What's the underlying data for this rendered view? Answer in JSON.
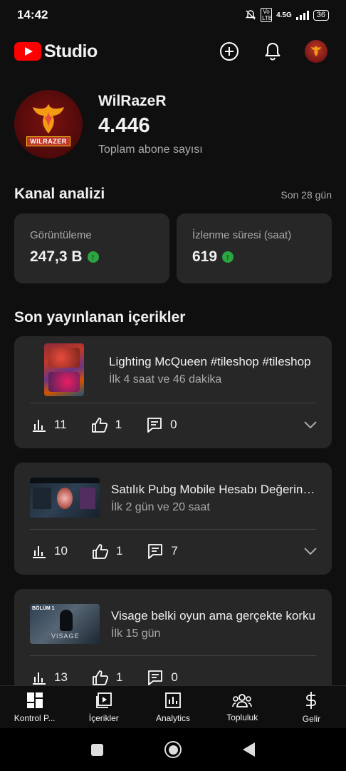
{
  "status": {
    "time": "14:42",
    "network": "4.5G",
    "volte": "Vo LTE",
    "battery": "36"
  },
  "header": {
    "logo_text": "Studio",
    "add_icon": "add-circle-icon",
    "bell_icon": "bell-icon"
  },
  "channel": {
    "name": "WilRazeR",
    "subscribers": "4.446",
    "subscribers_label": "Toplam abone sayısı",
    "avatar_brand": "WILRAZER"
  },
  "analytics": {
    "title": "Kanal analizi",
    "period": "Son 28 gün",
    "cards": [
      {
        "label": "Görüntüleme",
        "value": "247,3 B",
        "trend": "up"
      },
      {
        "label": "İzlenme süresi (saat)",
        "value": "619",
        "trend": "up"
      }
    ]
  },
  "recent": {
    "title": "Son yayınlanan içerikler",
    "videos": [
      {
        "title": "Lighting McQueen #tileshop #tileshop",
        "time": "İlk 4 saat ve 46 dakika",
        "views": "11",
        "likes": "1",
        "comments": "0",
        "thumb_style": "vertical"
      },
      {
        "title": "Satılık Pubg Mobile Hesabı Değerini Öğren",
        "time": "İlk 2 gün ve 20 saat",
        "views": "10",
        "likes": "1",
        "comments": "7",
        "thumb_style": "pubg"
      },
      {
        "title": "Visage belki oyun ama gerçekte korku",
        "time": "İlk 15 gün",
        "views": "13",
        "likes": "1",
        "comments": "0",
        "thumb_style": "visage",
        "thumb_text": "VISAGE",
        "thumb_badge": "BÖLÜM 1"
      }
    ]
  },
  "nav": [
    {
      "label": "Kontrol P...",
      "icon": "dashboard-icon"
    },
    {
      "label": "İçerikler",
      "icon": "content-icon"
    },
    {
      "label": "Analytics",
      "icon": "analytics-icon"
    },
    {
      "label": "Topluluk",
      "icon": "community-icon"
    },
    {
      "label": "Gelir",
      "icon": "earn-icon"
    }
  ],
  "colors": {
    "background": "#0f0f0f",
    "card": "#272727",
    "accent_red": "#ff0000",
    "trend_green": "#2ba640",
    "muted_text": "#aaaaaa"
  }
}
